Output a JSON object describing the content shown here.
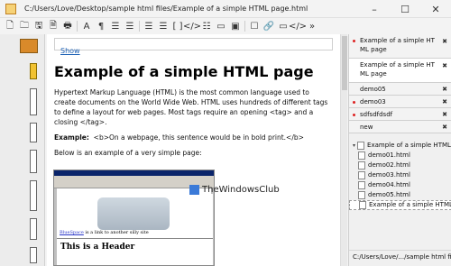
{
  "window": {
    "title": "C:/Users/Love/Desktop/sample html files/Example of a simple HTML page.html",
    "minimize": "–",
    "maximize": "☐",
    "close": "✕"
  },
  "toolbar": [
    "🗋",
    "🗀",
    "🖫",
    "🗎",
    "🖶",
    "A",
    "¶",
    "☰",
    "☰",
    "☰",
    "☰",
    "[ ]",
    "</>",
    "☷",
    "▭",
    "▣",
    "☐",
    "🔗",
    "▭",
    "</>",
    "»"
  ],
  "editor": {
    "show_link": "Show",
    "heading": "Example of a simple HTML page",
    "paragraph": "Hypertext Markup Language (HTML) is the most common language used to create documents on the World Wide Web. HTML uses hundreds of different tags to define a layout for web pages. Most tags require an opening <tag> and a closing </tag>.",
    "example_label": "Example:",
    "example_text": "<b>On a webpage, this sentence would be in bold print.</b>",
    "below": "Below is an example of a very simple page:",
    "shot_link_u": "BlueSpace",
    "shot_link_rest": " is a link to another silly site",
    "shot_header": "This is a Header"
  },
  "watermark": "TheWindowsClub",
  "tabs": [
    {
      "label": "Example of a simple HT ML page",
      "dot": true,
      "active": false,
      "two": true
    },
    {
      "label": "Example of a simple HT ML page",
      "dot": false,
      "active": true,
      "two": true
    },
    {
      "label": "demo05",
      "dot": false,
      "active": false,
      "two": false
    },
    {
      "label": "demo03",
      "dot": true,
      "active": false,
      "two": false
    },
    {
      "label": "sdfsdfdsdf",
      "dot": true,
      "active": false,
      "two": false
    },
    {
      "label": "new",
      "dot": false,
      "active": false,
      "two": false
    }
  ],
  "tree": {
    "root": "Example of a simple HTML page",
    "children": [
      "demo01.html",
      "demo02.html",
      "demo03.html",
      "demo04.html",
      "demo05.html",
      "Example of a simple HTML page"
    ]
  },
  "status": "C:/Users/Love/.../sample html files"
}
